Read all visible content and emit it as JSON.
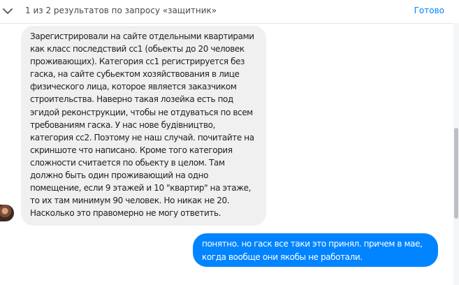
{
  "header": {
    "search_status": "1 из 2 результатов по запросу «защитник»",
    "done_label": "Готово",
    "chevron_icon": "chevron-down-icon"
  },
  "messages": {
    "incoming_lines": [
      "Зарегистрировали на сайте отдельными квартирами",
      "как класс последствий сс1 (обьекты до 20 человек",
      "проживающих). Категория сс1 регистрируется без",
      "гаска,  на сайте субьектом хозяйствования в лице",
      "физического лица, которое является заказчиком",
      "строительства. Наверно такая лозейка есть под",
      "эгидой реконструкции, чтобы не отдуваться по всем",
      "требованиям гаска.  У нас нове будівництво,",
      "категория сс2. Поэтому не наш случай. почитайте на",
      "скриншоте что написано. Кроме того категория",
      "сложности считается по обьекту в целом. Там",
      "должно быть один проживающий на одно",
      "помещение, если 9 этажей и 10 \"квартир\" на этаже,",
      "то их там минимум 90 человек. Но никак не 20.",
      "Насколько это правомерно не могу ответить."
    ],
    "outgoing_lines": [
      "понятно. но гаск все таки это принял. причем в мае,",
      "когда вообще они якобы не работали."
    ]
  },
  "colors": {
    "accent": "#0084ff",
    "incoming_bubble": "#f1f0f0",
    "text": "#1c1e21"
  }
}
